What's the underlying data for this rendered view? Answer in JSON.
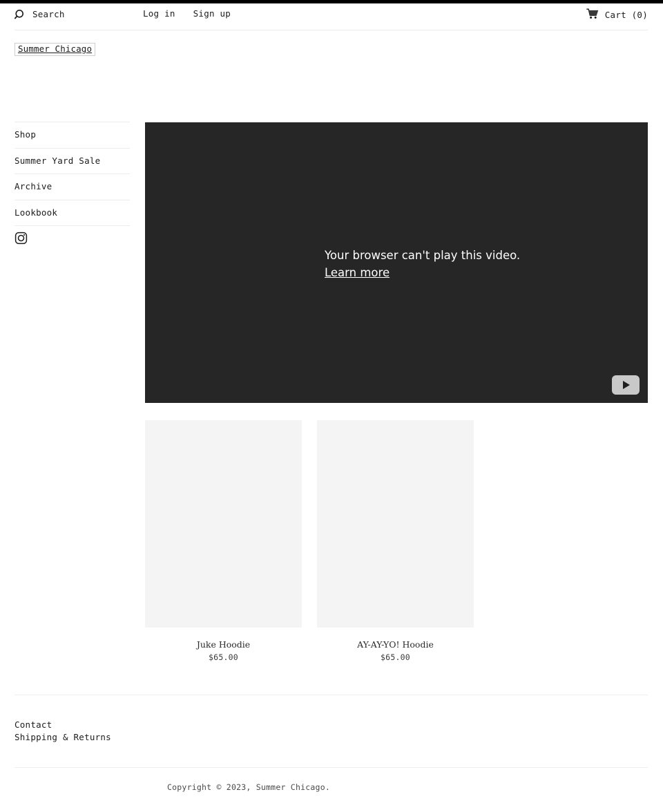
{
  "site": {
    "logo_alt": "Summer Chicago"
  },
  "header": {
    "search_icon": "search-icon",
    "search_label": "Search",
    "login_label": "Log in",
    "signup_label": "Sign up",
    "cart_icon": "shopping-cart-icon",
    "cart_label": "Cart (0)"
  },
  "sidebar": {
    "items": [
      {
        "label": "Shop"
      },
      {
        "label": "Summer Yard Sale"
      },
      {
        "label": "Archive"
      },
      {
        "label": "Lookbook"
      }
    ],
    "social": [
      {
        "icon": "instagram-icon",
        "label": "Instagram"
      }
    ]
  },
  "video": {
    "error_message": "Your browser can't play this video.",
    "learn_more_label": "Learn more",
    "play_icon": "play-icon",
    "background_color": "#262626"
  },
  "products": [
    {
      "title": "Juke Hoodie",
      "price": "$65.00"
    },
    {
      "title": "AY-AY-YO! Hoodie",
      "price": "$65.00"
    }
  ],
  "footer": {
    "links": [
      {
        "label": "Contact"
      },
      {
        "label": "Shipping & Returns"
      }
    ],
    "copyright": "Copyright © 2023, Summer Chicago."
  }
}
